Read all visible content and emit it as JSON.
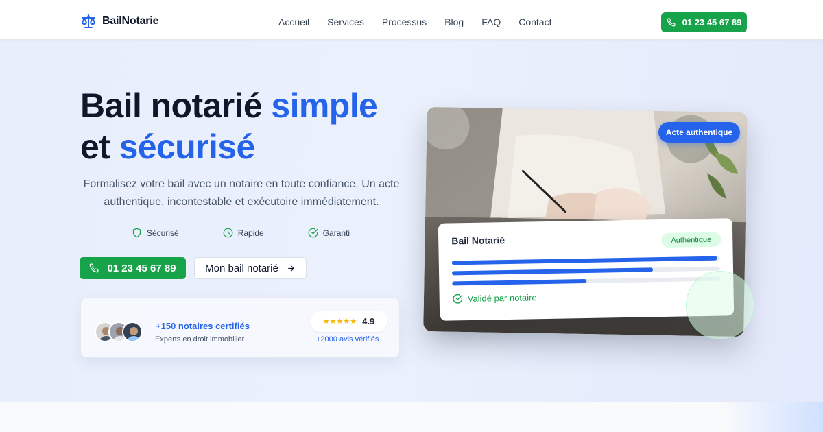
{
  "nav": {
    "brand": "BailNotarie",
    "links": [
      "Accueil",
      "Services",
      "Processus",
      "Blog",
      "FAQ",
      "Contact"
    ],
    "phone": "01 23 45 67 89"
  },
  "hero": {
    "title_part1": "Bail notarié ",
    "title_accent1": "simple",
    "title_part2": "et ",
    "title_accent2": "sécurisé",
    "description": "Formalisez votre bail avec un notaire en toute confiance. Un acte authentique, incontestable et exécutoire immédiatement.",
    "features": [
      "Sécurisé",
      "Rapide",
      "Garanti"
    ],
    "cta_phone": "01 23 45 67 89",
    "cta_secondary": "Mon bail notarié"
  },
  "social_proof": {
    "notaires_title": "+150 notaires certifiés",
    "notaires_subtitle": "Experts en droit immobilier",
    "stars": "★★★★★",
    "rating": "4.9",
    "reviews": "+2000 avis vérifiés"
  },
  "visual": {
    "badge": "Acte authentique",
    "card_title": "Bail Notarié",
    "card_badge": "Authentique",
    "progress": [
      0.99,
      0.75,
      0.5
    ],
    "validated": "Validé par notaire"
  },
  "colors": {
    "accent_blue": "#2563eb",
    "accent_green": "#16a34a",
    "text_dark": "#0f172a"
  },
  "icons": {
    "brand": "scales-icon",
    "phone": "phone-icon",
    "arrow": "arrow-right-icon",
    "features": [
      "shield-icon",
      "clock-icon",
      "check-circle-icon"
    ]
  }
}
